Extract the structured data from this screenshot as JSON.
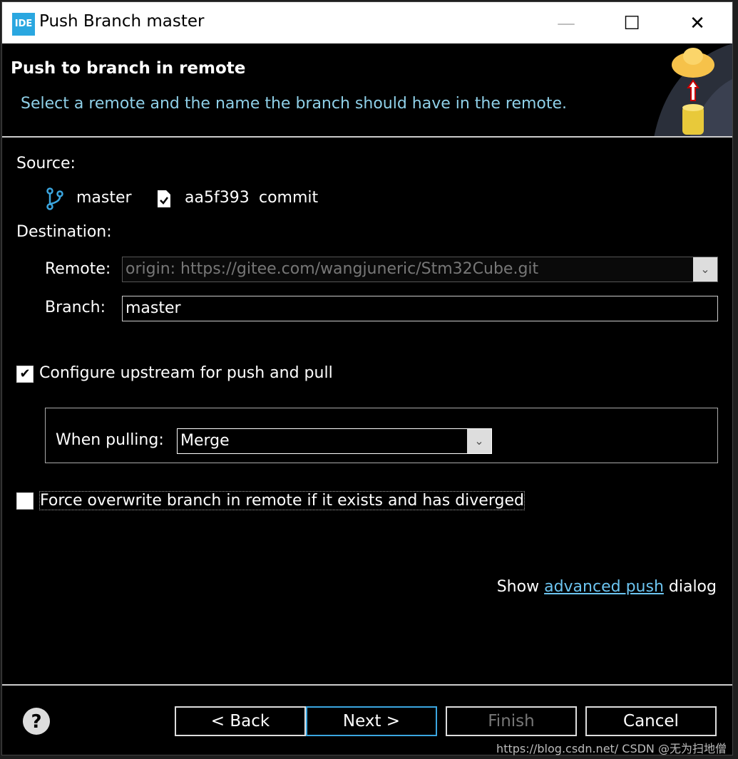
{
  "window": {
    "title": "Push Branch master",
    "logo": "IDE"
  },
  "header": {
    "title": "Push to branch in remote",
    "description": "Select a remote and the name the branch should have in the remote."
  },
  "source": {
    "label": "Source:",
    "branch": "master",
    "commit_id": "aa5f393",
    "commit_message": "commit"
  },
  "destination": {
    "label": "Destination:",
    "remote_label": "Remote:",
    "remote_value": "origin: https://gitee.com/wangjuneric/Stm32Cube.git",
    "branch_label": "Branch:",
    "branch_value": "master"
  },
  "upstream": {
    "label": "Configure upstream for push and pull",
    "checked": true,
    "when_pulling_label": "When pulling:",
    "when_pulling_value": "Merge"
  },
  "force": {
    "label": "Force overwrite branch in remote if it exists and has diverged",
    "checked": false
  },
  "advanced": {
    "prefix": "Show",
    "link": "advanced push",
    "suffix": "dialog"
  },
  "buttons": {
    "back": "< Back",
    "next": "Next >",
    "finish": "Finish",
    "cancel": "Cancel"
  },
  "watermark": "https://blog.csdn.net/  CSDN @无为扫地僧"
}
